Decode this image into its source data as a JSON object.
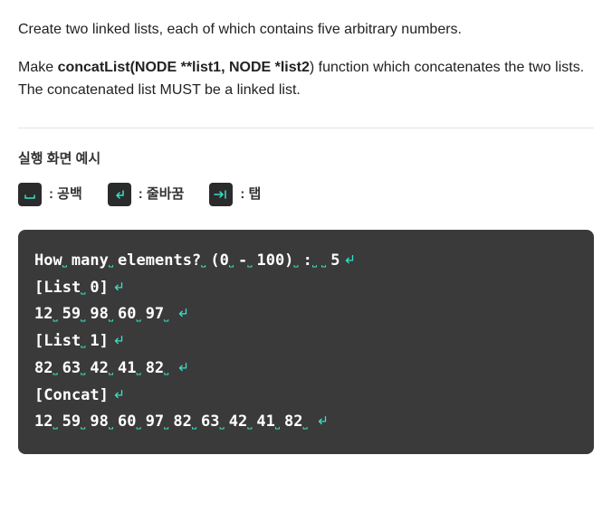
{
  "desc": {
    "p1": "Create two linked lists, each of which contains five arbitrary numbers.",
    "p2_pre": "Make ",
    "p2_b": "concatList(NODE **list1, NODE *list2",
    "p2_post": ") function which concatenates the two lists. The concatenated list MUST be a linked list."
  },
  "section_title": "실행 화면 예시",
  "legend": {
    "space": ": 공백",
    "newline": ": 줄바꿈",
    "tab": ": 탭"
  },
  "terminal": {
    "lines": [
      {
        "tokens": [
          "How",
          "many",
          "elements?",
          "(0",
          "-",
          "100)",
          ":",
          "",
          "5"
        ],
        "nl": true
      },
      {
        "tokens": [
          "[List",
          "0]"
        ],
        "nl": true
      },
      {
        "tokens": [
          "12",
          "59",
          "98",
          "60",
          "97",
          ""
        ],
        "nl": true
      },
      {
        "tokens": [
          "[List",
          "1]"
        ],
        "nl": true
      },
      {
        "tokens": [
          "82",
          "63",
          "42",
          "41",
          "82",
          ""
        ],
        "nl": true
      },
      {
        "tokens": [
          "[Concat]"
        ],
        "nl": true
      },
      {
        "tokens": [
          "12",
          "59",
          "98",
          "60",
          "97",
          "82",
          "63",
          "42",
          "41",
          "82",
          ""
        ],
        "nl": true
      }
    ]
  },
  "icons": {
    "space_glyph": "space",
    "newline_glyph": "newline",
    "tab_glyph": "tab"
  }
}
